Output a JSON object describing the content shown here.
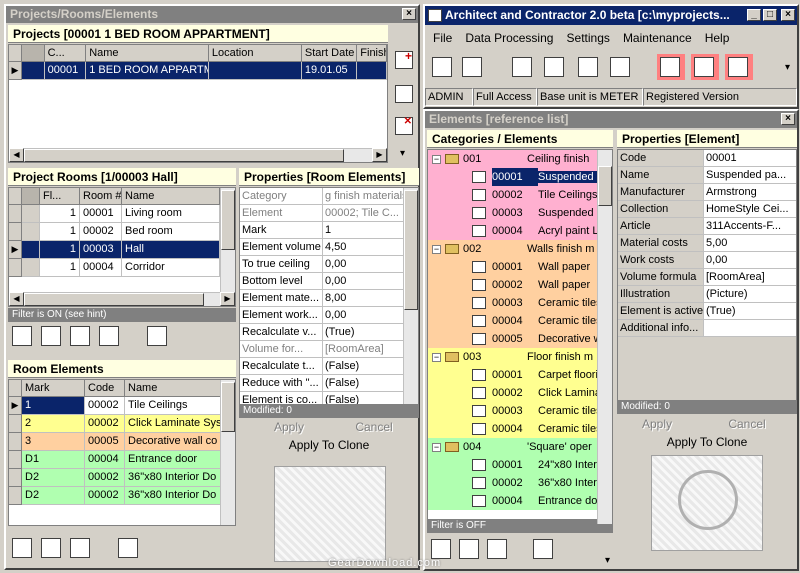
{
  "left_window": {
    "title": "Projects/Rooms/Elements",
    "projects": {
      "header": "Projects [00001 1 BED ROOM APPARTMENT]",
      "columns": [
        "C...",
        "Name",
        "Location",
        "Start Date",
        "Finish"
      ],
      "rows": [
        {
          "code": "00001",
          "name": "1 BED ROOM APPARTMEN",
          "location": "",
          "start": "19.01.05",
          "finish": ""
        }
      ]
    },
    "rooms": {
      "header": "Project Rooms [1/00003 Hall]",
      "columns": [
        "Fl...",
        "Room #",
        "Name"
      ],
      "rows": [
        {
          "fl": "1",
          "room": "00001",
          "name": "Living room"
        },
        {
          "fl": "1",
          "room": "00002",
          "name": "Bed room"
        },
        {
          "fl": "1",
          "room": "00003",
          "name": "Hall"
        },
        {
          "fl": "1",
          "room": "00004",
          "name": "Corridor"
        }
      ],
      "filter": "Filter is ON (see hint)"
    },
    "room_props": {
      "header": "Properties [Room Elements]",
      "rows": [
        {
          "k": "Category",
          "v": "g finish materials",
          "grey": true
        },
        {
          "k": "Element",
          "v": "00002; Tile C...",
          "grey": true
        },
        {
          "k": "Mark",
          "v": "1",
          "grey": false
        },
        {
          "k": "Element volume",
          "v": "4,50",
          "grey": false
        },
        {
          "k": "To true ceiling",
          "v": "0,00",
          "grey": false
        },
        {
          "k": "Bottom level",
          "v": "0,00",
          "grey": false
        },
        {
          "k": "Element mate...",
          "v": "8,00",
          "grey": false
        },
        {
          "k": "Element work...",
          "v": "0,00",
          "grey": false
        },
        {
          "k": "Recalculate v...",
          "v": "(True)",
          "grey": false
        },
        {
          "k": "Volume for...",
          "v": "[RoomArea]",
          "grey": true
        },
        {
          "k": "Recalculate t...",
          "v": "(False)",
          "grey": false
        },
        {
          "k": "Reduce with \"...",
          "v": "(False)",
          "grey": false
        },
        {
          "k": "Element is co...",
          "v": "(False)",
          "grey": false
        }
      ],
      "status": "Modified: 0",
      "apply": "Apply",
      "cancel": "Cancel",
      "apply_clone": "Apply To Clone"
    },
    "elements": {
      "header": "Room Elements",
      "columns": [
        "Mark",
        "Code",
        "Name"
      ],
      "rows": [
        {
          "mark": "1",
          "code": "00002",
          "name": "Tile Ceilings",
          "color": "#ffffff"
        },
        {
          "mark": "2",
          "code": "00002",
          "name": "Click Laminate Syst",
          "color": "#ffff90"
        },
        {
          "mark": "3",
          "code": "00005",
          "name": "Decorative wall co",
          "color": "#ffd0a0"
        },
        {
          "mark": "D1",
          "code": "00004",
          "name": "Entrance door",
          "color": "#b0ffb0"
        },
        {
          "mark": "D2",
          "code": "00002",
          "name": "36\"x80 Interior Do",
          "color": "#b0ffb0"
        },
        {
          "mark": "D2",
          "code": "00002",
          "name": "36\"x80 Interior Do",
          "color": "#b0ffb0"
        }
      ]
    }
  },
  "right_window": {
    "title": "Architect and Contractor 2.0 beta [c:\\myprojects...",
    "menu": [
      "File",
      "Data Processing",
      "Settings",
      "Maintenance",
      "Help"
    ],
    "status": [
      "ADMIN",
      "Full Access",
      "Base unit is METER",
      "Registered Version"
    ]
  },
  "elements_window": {
    "title": "Elements [reference list]",
    "cat_header": "Categories / Elements",
    "groups": [
      {
        "code": "001",
        "name": "Ceiling finish",
        "color": "#ffb0d0",
        "items": [
          {
            "code": "00001",
            "name": "Suspended p",
            "sel": true
          },
          {
            "code": "00002",
            "name": "Tile Ceilings",
            "sel": false
          },
          {
            "code": "00003",
            "name": "Suspended m",
            "sel": false
          },
          {
            "code": "00004",
            "name": "Acryl paint Lc",
            "sel": false
          }
        ]
      },
      {
        "code": "002",
        "name": "Walls finish m",
        "color": "#ffd0a0",
        "items": [
          {
            "code": "00001",
            "name": "Wall paper",
            "sel": false
          },
          {
            "code": "00002",
            "name": "Wall paper",
            "sel": false
          },
          {
            "code": "00003",
            "name": "Ceramic tiles",
            "sel": false
          },
          {
            "code": "00004",
            "name": "Ceramic tiles",
            "sel": false
          },
          {
            "code": "00005",
            "name": "Decorative w",
            "sel": false
          }
        ]
      },
      {
        "code": "003",
        "name": "Floor finish m",
        "color": "#ffff90",
        "items": [
          {
            "code": "00001",
            "name": "Carpet floori",
            "sel": false
          },
          {
            "code": "00002",
            "name": "Click Laminat",
            "sel": false
          },
          {
            "code": "00003",
            "name": "Ceramic tiles",
            "sel": false
          },
          {
            "code": "00004",
            "name": "Ceramic tiles",
            "sel": false
          }
        ]
      },
      {
        "code": "004",
        "name": "'Square' oper",
        "color": "#b0ffb0",
        "items": [
          {
            "code": "00001",
            "name": "24\"x80 Inter",
            "sel": false
          },
          {
            "code": "00002",
            "name": "36\"x80 Inter",
            "sel": false
          },
          {
            "code": "00004",
            "name": "Entrance do",
            "sel": false
          }
        ]
      }
    ],
    "filter": "Filter is OFF",
    "props_header": "Properties [Element]",
    "props": [
      {
        "k": "Code",
        "v": "00001"
      },
      {
        "k": "Name",
        "v": "Suspended pa..."
      },
      {
        "k": "Manufacturer",
        "v": "Armstrong"
      },
      {
        "k": "Collection",
        "v": "HomeStyle Cei..."
      },
      {
        "k": "Article",
        "v": "311Accents-F..."
      },
      {
        "k": "Material costs",
        "v": "5,00"
      },
      {
        "k": "Work costs",
        "v": "0,00"
      },
      {
        "k": "Volume formula",
        "v": "[RoomArea]"
      },
      {
        "k": "Illustration",
        "v": "(Picture)"
      },
      {
        "k": "Element is active",
        "v": "(True)"
      },
      {
        "k": "Additional info...",
        "v": ""
      }
    ],
    "status": "Modified: 0",
    "apply": "Apply",
    "cancel": "Cancel",
    "apply_clone": "Apply To Clone"
  },
  "watermark": "GearDownload.com"
}
